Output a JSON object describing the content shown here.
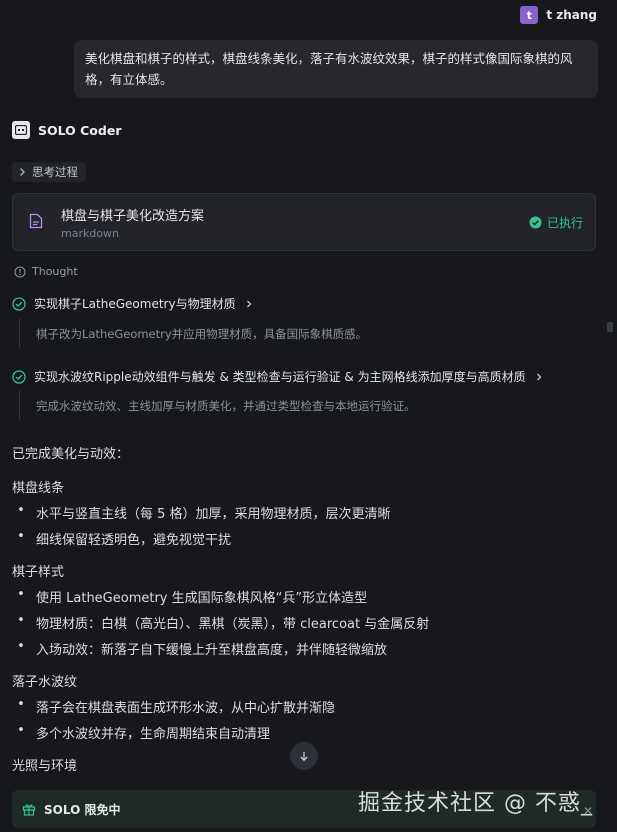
{
  "user": {
    "initial": "t",
    "name": "t zhang"
  },
  "user_message": "美化棋盘和棋子的样式，棋盘线条美化，落子有水波纹效果，棋子的样式像国际象棋的风格，有立体感。",
  "agent": {
    "name": "SOLO Coder"
  },
  "thinking_label": "思考过程",
  "plan_card": {
    "title": "棋盘与棋子美化改造方案",
    "subtitle": "markdown",
    "status": "已执行",
    "status_color": "#34c38f"
  },
  "thought_label": "Thought",
  "steps": [
    {
      "title": "实现棋子LatheGeometry与物理材质",
      "desc": "棋子改为LatheGeometry并应用物理材质，具备国际象棋质感。"
    },
    {
      "title": "实现水波纹Ripple动效组件与触发 & 类型检查与运行验证 & 为主网格线添加厚度与高质材质",
      "desc": "完成水波纹动效、主线加厚与材质美化，并通过类型检查与本地运行验证。"
    }
  ],
  "summary": {
    "intro": "已完成美化与动效：",
    "sections": [
      {
        "heading": "棋盘线条",
        "items": [
          "水平与竖直主线（每 5 格）加厚，采用物理材质，层次更清晰",
          "细线保留轻透明色，避免视觉干扰"
        ]
      },
      {
        "heading": "棋子样式",
        "items": [
          "使用 LatheGeometry 生成国际象棋风格“兵”形立体造型",
          "物理材质：白棋（高光白）、黑棋（炭黑），带 clearcoat 与金属反射",
          "入场动效：新落子自下缓慢上升至棋盘高度，并伴随轻微缩放"
        ]
      },
      {
        "heading": "落子水波纹",
        "items": [
          "落子会在棋盘表面生成环形水波，从中心扩散并渐隐",
          "多个水波纹并存，生命周期结束自动清理"
        ]
      },
      {
        "heading": "光照与环境",
        "items": []
      }
    ]
  },
  "promo": {
    "label": "SOLO 限免中"
  },
  "watermark": "掘金技术社区 @ 不惑_",
  "icons": {
    "user_avatar": "avatar",
    "agent": "solo-logo-icon",
    "chevron": "chevron-right-icon",
    "file": "file-icon",
    "check": "check-circle-icon",
    "info": "info-icon",
    "down": "arrow-down-icon",
    "gift": "gift-icon"
  }
}
